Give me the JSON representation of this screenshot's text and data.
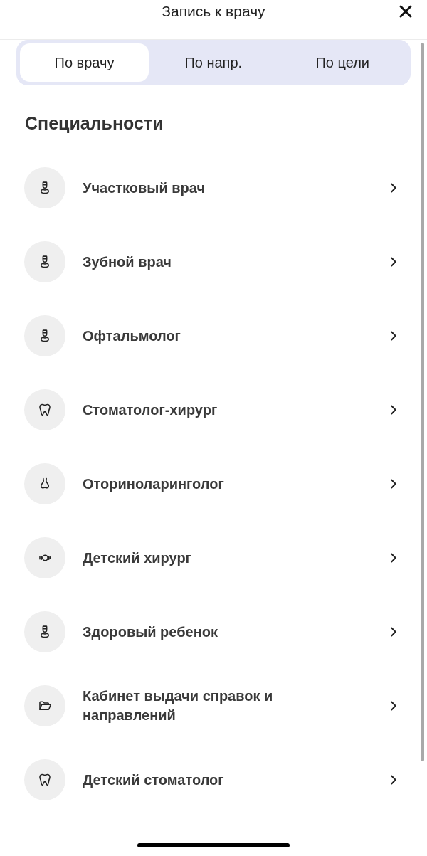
{
  "header": {
    "title": "Запись к врачу"
  },
  "tabs": [
    {
      "label": "По врачу",
      "selected": true
    },
    {
      "label": "По напр.",
      "selected": false
    },
    {
      "label": "По цели",
      "selected": false
    }
  ],
  "section": {
    "title": "Специальности"
  },
  "specialties": [
    {
      "kind": "doctor",
      "label": "Участковый врач"
    },
    {
      "kind": "doctor",
      "label": "Зубной врач"
    },
    {
      "kind": "doctor",
      "label": "Офтальмолог"
    },
    {
      "kind": "tooth",
      "label": "Стоматолог-хирург"
    },
    {
      "kind": "nose",
      "label": "Оториноларинголог"
    },
    {
      "kind": "ring",
      "label": "Детский хирург"
    },
    {
      "kind": "doctor",
      "label": "Здоровый ребенок"
    },
    {
      "kind": "folder",
      "label": "Кабинет выдачи справок и направлений"
    },
    {
      "kind": "tooth",
      "label": "Детский стоматолог"
    }
  ]
}
